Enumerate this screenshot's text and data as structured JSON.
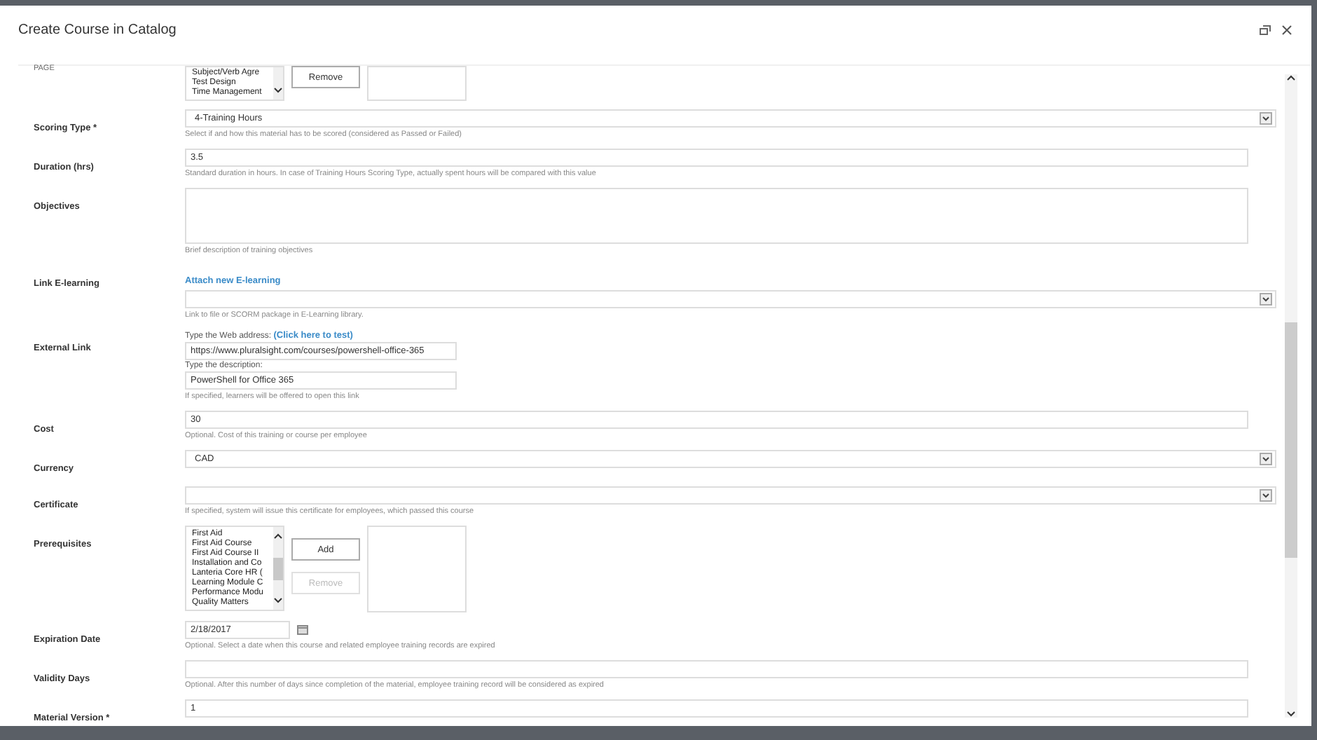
{
  "window": {
    "title": "Create Course in Catalog"
  },
  "ribbon": {
    "tab": "PAGE"
  },
  "fields": [
    {
      "kind": "picker",
      "items": [
        "Subject/Verb Agre",
        "Test Design",
        "Time Management"
      ],
      "buttons": [
        {
          "label": "Remove",
          "disabled": false
        }
      ]
    },
    {
      "kind": "select",
      "label": "Scoring Type *",
      "value": "4-Training Hours",
      "hint": "Select if and how this material has to be scored (considered as Passed or Failed)"
    },
    {
      "kind": "text",
      "label": "Duration (hrs)",
      "value": "3.5",
      "hint": "Standard duration in hours. In case of Training Hours Scoring Type, actually spent hours will be compared with this value"
    },
    {
      "kind": "textarea",
      "label": "Objectives",
      "hint": "Brief description of training objectives"
    },
    {
      "kind": "select",
      "label": "Link E-learning",
      "link": "Attach new E-learning",
      "hint": "Link to file or SCORM package in E-Learning library."
    },
    {
      "kind": "external",
      "label": "External Link",
      "prompt": "Type the Web address:",
      "link": "(Click here to test)",
      "value": "https://www.pluralsight.com/courses/powershell-office-365",
      "prompt2": "Type the description:",
      "value2": "PowerShell for Office 365",
      "hint": "If specified, learners will be offered to open this link"
    },
    {
      "kind": "text",
      "label": "Cost",
      "value": "30",
      "hint": "Optional. Cost of this training or course per employee"
    },
    {
      "kind": "select",
      "label": "Currency",
      "value": "CAD"
    },
    {
      "kind": "select",
      "label": "Certificate",
      "hint": "If specified, system will issue this certificate for employees, which passed this course"
    },
    {
      "kind": "picker",
      "label": "Prerequisites",
      "items": [
        "First Aid",
        "First Aid Course",
        "First Aid Course II",
        "Installation and Co",
        "Lanteria Core HR (",
        "Learning Module C",
        "Performance Modu",
        "Quality Matters"
      ],
      "buttons": [
        {
          "label": "Add",
          "disabled": false
        },
        {
          "label": "Remove",
          "disabled": true
        }
      ]
    },
    {
      "kind": "date",
      "label": "Expiration Date",
      "value": "2/18/2017",
      "hint": "Optional. Select a date when this course and related employee training records are expired"
    },
    {
      "kind": "text",
      "label": "Validity Days",
      "hint": "Optional. After this number of days since completion of the material, employee training record will be considered as expired"
    },
    {
      "kind": "text",
      "label": "Material Version *",
      "value": "1"
    }
  ]
}
